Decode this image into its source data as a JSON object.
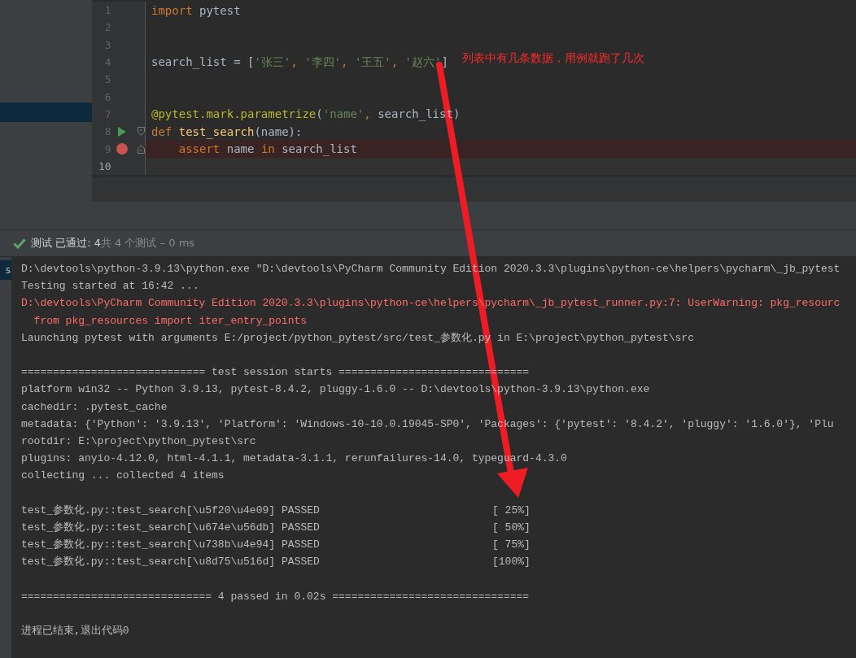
{
  "editor": {
    "lines": [
      {
        "number": "1",
        "tokens": [
          {
            "text": "import ",
            "kind": "keyword"
          },
          {
            "text": "pytest",
            "kind": "plain"
          }
        ]
      },
      {
        "number": "2"
      },
      {
        "number": "3"
      },
      {
        "number": "4",
        "tokens": [
          {
            "text": "search_list = [",
            "kind": "plain"
          },
          {
            "text": "'张三'",
            "kind": "string"
          },
          {
            "text": ", ",
            "kind": "keyword"
          },
          {
            "text": "'李四'",
            "kind": "string"
          },
          {
            "text": ", ",
            "kind": "keyword"
          },
          {
            "text": "'王五'",
            "kind": "string"
          },
          {
            "text": ", ",
            "kind": "keyword"
          },
          {
            "text": "'赵六'",
            "kind": "string"
          },
          {
            "text": "]",
            "kind": "plain"
          }
        ]
      },
      {
        "number": "5"
      },
      {
        "number": "6"
      },
      {
        "number": "7",
        "tokens": [
          {
            "text": "@pytest.mark.parametrize",
            "kind": "decorator"
          },
          {
            "text": "(",
            "kind": "plain"
          },
          {
            "text": "'name'",
            "kind": "string"
          },
          {
            "text": ", ",
            "kind": "keyword"
          },
          {
            "text": "search_list)",
            "kind": "plain"
          }
        ]
      },
      {
        "number": "8",
        "runnable": true,
        "fold_start": true,
        "tokens": [
          {
            "text": "def ",
            "kind": "keyword"
          },
          {
            "text": "test_search",
            "kind": "function"
          },
          {
            "text": "(name):",
            "kind": "plain"
          }
        ]
      },
      {
        "number": "9",
        "breakpoint": true,
        "fold_end": true,
        "tokens": [
          {
            "text": "    assert ",
            "kind": "keyword"
          },
          {
            "text": "name ",
            "kind": "plain"
          },
          {
            "text": "in ",
            "kind": "keyword"
          },
          {
            "text": "search_list",
            "kind": "plain"
          }
        ]
      },
      {
        "number": "10",
        "current": true
      }
    ]
  },
  "annotation": {
    "text": "列表中有几条数据，用例就跑了几次"
  },
  "test_status": {
    "passed": true,
    "summary": "测试 已通过: 4",
    "details": "共 4 个测试 – 0 ms"
  },
  "console": {
    "tool_tab": "s",
    "lines": [
      {
        "kind": "plain",
        "text": "D:\\devtools\\python-3.9.13\\python.exe \"D:\\devtools\\PyCharm Community Edition 2020.3.3\\plugins\\python-ce\\helpers\\pycharm\\_jb_pytest"
      },
      {
        "kind": "plain",
        "text": "Testing started at 16:42 ..."
      },
      {
        "kind": "error",
        "text": "D:\\devtools\\PyCharm Community Edition 2020.3.3\\plugins\\python-ce\\helpers\\pycharm\\_jb_pytest_runner.py:7: UserWarning: pkg_resourc"
      },
      {
        "kind": "error",
        "text": "  from pkg_resources import iter_entry_points"
      },
      {
        "kind": "plain",
        "text": "Launching pytest with arguments E:/project/python_pytest/src/test_参数化.py in E:\\project\\python_pytest\\src"
      },
      {
        "kind": "blank"
      },
      {
        "kind": "plain",
        "text": "============================= test session starts =============================="
      },
      {
        "kind": "plain",
        "text": "platform win32 -- Python 3.9.13, pytest-8.4.2, pluggy-1.6.0 -- D:\\devtools\\python-3.9.13\\python.exe"
      },
      {
        "kind": "plain",
        "text": "cachedir: .pytest_cache"
      },
      {
        "kind": "plain",
        "text": "metadata: {'Python': '3.9.13', 'Platform': 'Windows-10-10.0.19045-SP0', 'Packages': {'pytest': '8.4.2', 'pluggy': '1.6.0'}, 'Plu"
      },
      {
        "kind": "plain",
        "text": "rootdir: E:\\project\\python_pytest\\src"
      },
      {
        "kind": "plain",
        "text": "plugins: anyio-4.12.0, html-4.1.1, metadata-3.1.1, rerunfailures-14.0, typeguard-4.3.0"
      },
      {
        "kind": "plain",
        "text": "collecting ... collected 4 items"
      },
      {
        "kind": "blank"
      },
      {
        "kind": "result",
        "test": "test_参数化.py::test_search[\\u5f20\\u4e09]",
        "status": "PASSED",
        "progress": "[ 25%]"
      },
      {
        "kind": "result",
        "test": "test_参数化.py::test_search[\\u674e\\u56db]",
        "status": "PASSED",
        "progress": "[ 50%]"
      },
      {
        "kind": "result",
        "test": "test_参数化.py::test_search[\\u738b\\u4e94]",
        "status": "PASSED",
        "progress": "[ 75%]"
      },
      {
        "kind": "result",
        "test": "test_参数化.py::test_search[\\u8d75\\u516d]",
        "status": "PASSED",
        "progress": "[100%]"
      },
      {
        "kind": "blank"
      },
      {
        "kind": "plain",
        "text": "============================== 4 passed in 0.02s ==============================="
      },
      {
        "kind": "blank"
      },
      {
        "kind": "plain",
        "text": "进程已结束,退出代码0"
      }
    ]
  }
}
